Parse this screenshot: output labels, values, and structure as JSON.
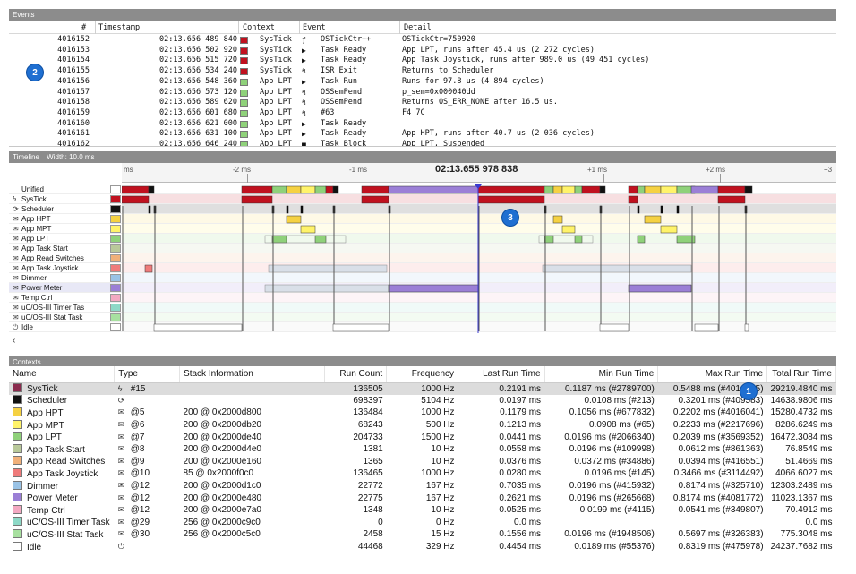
{
  "events_panel": {
    "title": "Events",
    "columns": [
      "#",
      "Timestamp",
      "Context",
      "Event",
      "Detail"
    ],
    "rows": [
      {
        "idx": "4016152",
        "ts": "02:13.656 489 840",
        "ctx": "SysTick",
        "color": "#c0111f",
        "icon": "ƒ",
        "event": "OSTickCtr++",
        "detail": "OSTickCtr=750920"
      },
      {
        "idx": "4016153",
        "ts": "02:13.656 502 920",
        "ctx": "SysTick",
        "color": "#c0111f",
        "icon": "▶",
        "event": "Task Ready",
        "detail": "App LPT, runs after 45.4 us (2 272 cycles)"
      },
      {
        "idx": "4016154",
        "ts": "02:13.656 515 720",
        "ctx": "SysTick",
        "color": "#c0111f",
        "icon": "▶",
        "event": "Task Ready",
        "detail": "App Task Joystick, runs after 989.0 us (49 451 cycles)"
      },
      {
        "idx": "4016155",
        "ts": "02:13.656 534 240",
        "ctx": "SysTick",
        "color": "#c0111f",
        "icon": "↯",
        "event": "ISR Exit",
        "detail": "Returns to Scheduler"
      },
      {
        "idx": "4016156",
        "ts": "02:13.656 548 360",
        "ctx": "App LPT",
        "color": "#8fd17a",
        "icon": "▶",
        "event": "Task Run",
        "detail": "Runs for 97.8 us (4 894 cycles)"
      },
      {
        "idx": "4016157",
        "ts": "02:13.656 573 120",
        "ctx": "App LPT",
        "color": "#8fd17a",
        "icon": "↯",
        "event": "OSSemPend",
        "detail": "p_sem=0x000040dd"
      },
      {
        "idx": "4016158",
        "ts": "02:13.656 589 620",
        "ctx": "App LPT",
        "color": "#8fd17a",
        "icon": "↯",
        "event": "OSSemPend",
        "detail": "Returns OS_ERR_NONE after 16.5 us."
      },
      {
        "idx": "4016159",
        "ts": "02:13.656 601 680",
        "ctx": "App LPT",
        "color": "#8fd17a",
        "icon": "↯",
        "event": "#63",
        "detail": "F4 7C"
      },
      {
        "idx": "4016160",
        "ts": "02:13.656 621 000",
        "ctx": "App LPT",
        "color": "#8fd17a",
        "icon": "▶",
        "event": "Task Ready",
        "detail": ""
      },
      {
        "idx": "4016161",
        "ts": "02:13.656 631 100",
        "ctx": "App LPT",
        "color": "#8fd17a",
        "icon": "▶",
        "event": "Task Ready",
        "detail": "App HPT, runs after 40.7 us (2 036 cycles)"
      },
      {
        "idx": "4016162",
        "ts": "02:13.656 646 240",
        "ctx": "App LPT",
        "color": "#8fd17a",
        "icon": "■",
        "event": "Task Block",
        "detail": "App LPT, Suspended"
      }
    ]
  },
  "timeline_panel": {
    "title": "Timeline",
    "width_label": "Width:",
    "width_value": "10.0 ms",
    "cursor_time": "02:13.655 978 838",
    "ticks": [
      "ms",
      "-2 ms",
      "-1 ms",
      "+1 ms",
      "+2 ms",
      "+3"
    ],
    "scroll_arrow": "‹",
    "tracks": [
      {
        "name": "Unified",
        "icon": "",
        "color": "#ffffff"
      },
      {
        "name": "SysTick",
        "icon": "ϟ",
        "color": "#c0111f"
      },
      {
        "name": "Scheduler",
        "icon": "⟳",
        "color": "#111111"
      },
      {
        "name": "App HPT",
        "icon": "✉",
        "color": "#f5d142"
      },
      {
        "name": "App MPT",
        "icon": "✉",
        "color": "#fff36a"
      },
      {
        "name": "App LPT",
        "icon": "✉",
        "color": "#8fd17a"
      },
      {
        "name": "App Task Start",
        "icon": "✉",
        "color": "#b9c99a"
      },
      {
        "name": "App Read Switches",
        "icon": "✉",
        "color": "#f0b07a"
      },
      {
        "name": "App Task Joystick",
        "icon": "✉",
        "color": "#ef7b7b"
      },
      {
        "name": "Dimmer",
        "icon": "✉",
        "color": "#9ac3e6"
      },
      {
        "name": "Power Meter",
        "icon": "✉",
        "color": "#9b7fd6"
      },
      {
        "name": "Temp Ctrl",
        "icon": "✉",
        "color": "#f3a9c2"
      },
      {
        "name": "uC/OS-III Timer Tas",
        "icon": "✉",
        "color": "#8ed9c7"
      },
      {
        "name": "uC/OS-III Stat Task",
        "icon": "✉",
        "color": "#a8e0a0"
      },
      {
        "name": "Idle",
        "icon": "⏻",
        "color": "#ffffff"
      }
    ]
  },
  "contexts_panel": {
    "title": "Contexts",
    "columns": [
      "Name",
      "Type",
      "Stack Information",
      "Run Count",
      "Frequency",
      "Last Run Time",
      "Min Run Time",
      "Max Run Time",
      "Total Run Time"
    ],
    "rows": [
      {
        "name": "SysTick",
        "color": "#8a2b4e",
        "ticon": "ϟ",
        "type": "#15",
        "stack": "",
        "runs": "136505",
        "freq": "1000 Hz",
        "last": "0.2191 ms",
        "min": "0.1187 ms (#2789700)",
        "max": "0.5488 ms (#4016155)",
        "total": "29219.4840 ms"
      },
      {
        "name": "Scheduler",
        "color": "#111111",
        "ticon": "⟳",
        "type": "",
        "stack": "",
        "runs": "698397",
        "freq": "5104 Hz",
        "last": "0.0197 ms",
        "min": "0.0108 ms (#213)",
        "max": "0.3201 ms (#409583)",
        "total": "14638.9806 ms"
      },
      {
        "name": "App HPT",
        "color": "#f5d142",
        "ticon": "✉",
        "type": "@5",
        "stack": "200 @ 0x2000d800",
        "runs": "136484",
        "freq": "1000 Hz",
        "last": "0.1179 ms",
        "min": "0.1056 ms (#677832)",
        "max": "0.2202 ms (#4016041)",
        "total": "15280.4732 ms"
      },
      {
        "name": "App MPT",
        "color": "#fff36a",
        "ticon": "✉",
        "type": "@6",
        "stack": "200 @ 0x2000db20",
        "runs": "68243",
        "freq": "500 Hz",
        "last": "0.1213 ms",
        "min": "0.0908 ms (#65)",
        "max": "0.2233 ms (#2217696)",
        "total": "8286.6249 ms"
      },
      {
        "name": "App LPT",
        "color": "#8fd17a",
        "ticon": "✉",
        "type": "@7",
        "stack": "200 @ 0x2000de40",
        "runs": "204733",
        "freq": "1500 Hz",
        "last": "0.0441 ms",
        "min": "0.0196 ms (#2066340)",
        "max": "0.2039 ms (#3569352)",
        "total": "16472.3084 ms"
      },
      {
        "name": "App Task Start",
        "color": "#b9c99a",
        "ticon": "✉",
        "type": "@8",
        "stack": "200 @ 0x2000d4e0",
        "runs": "1381",
        "freq": "10 Hz",
        "last": "0.0558 ms",
        "min": "0.0196 ms (#109998)",
        "max": "0.0612 ms (#861363)",
        "total": "76.8549 ms"
      },
      {
        "name": "App Read Switches",
        "color": "#f0b07a",
        "ticon": "✉",
        "type": "@9",
        "stack": "200 @ 0x2000e160",
        "runs": "1365",
        "freq": "10 Hz",
        "last": "0.0376 ms",
        "min": "0.0372 ms (#34886)",
        "max": "0.0394 ms (#416551)",
        "total": "51.4669 ms"
      },
      {
        "name": "App Task Joystick",
        "color": "#ef7b7b",
        "ticon": "✉",
        "type": "@10",
        "stack": "85 @ 0x2000f0c0",
        "runs": "136465",
        "freq": "1000 Hz",
        "last": "0.0280 ms",
        "min": "0.0196 ms (#145)",
        "max": "0.3466 ms (#3114492)",
        "total": "4066.6027 ms"
      },
      {
        "name": "Dimmer",
        "color": "#9ac3e6",
        "ticon": "✉",
        "type": "@12",
        "stack": "200 @ 0x2000d1c0",
        "runs": "22772",
        "freq": "167 Hz",
        "last": "0.7035 ms",
        "min": "0.0196 ms (#415932)",
        "max": "0.8174 ms (#325710)",
        "total": "12303.2489 ms"
      },
      {
        "name": "Power Meter",
        "color": "#9b7fd6",
        "ticon": "✉",
        "type": "@12",
        "stack": "200 @ 0x2000e480",
        "runs": "22775",
        "freq": "167 Hz",
        "last": "0.2621 ms",
        "min": "0.0196 ms (#265668)",
        "max": "0.8174 ms (#4081772)",
        "total": "11023.1367 ms"
      },
      {
        "name": "Temp Ctrl",
        "color": "#f3a9c2",
        "ticon": "✉",
        "type": "@12",
        "stack": "200 @ 0x2000e7a0",
        "runs": "1348",
        "freq": "10 Hz",
        "last": "0.0525 ms",
        "min": "0.0199 ms (#4115)",
        "max": "0.0541 ms (#349807)",
        "total": "70.4912 ms"
      },
      {
        "name": "uC/OS-III Timer Task",
        "color": "#8ed9c7",
        "ticon": "✉",
        "type": "@29",
        "stack": "256 @ 0x2000c9c0",
        "runs": "0",
        "freq": "0 Hz",
        "last": "0.0 ms",
        "min": "",
        "max": "",
        "total": "0.0 ms"
      },
      {
        "name": "uC/OS-III Stat Task",
        "color": "#a8e0a0",
        "ticon": "✉",
        "type": "@30",
        "stack": "256 @ 0x2000c5c0",
        "runs": "2458",
        "freq": "15 Hz",
        "last": "0.1556 ms",
        "min": "0.0196 ms (#1948506)",
        "max": "0.5697 ms (#326383)",
        "total": "775.3048 ms"
      },
      {
        "name": "Idle",
        "color": "#ffffff",
        "ticon": "⏻",
        "type": "",
        "stack": "",
        "runs": "44468",
        "freq": "329 Hz",
        "last": "0.4454 ms",
        "min": "0.0189 ms (#55376)",
        "max": "0.8319 ms (#475978)",
        "total": "24237.7682 ms"
      }
    ]
  },
  "callouts": [
    "1",
    "2",
    "3"
  ]
}
